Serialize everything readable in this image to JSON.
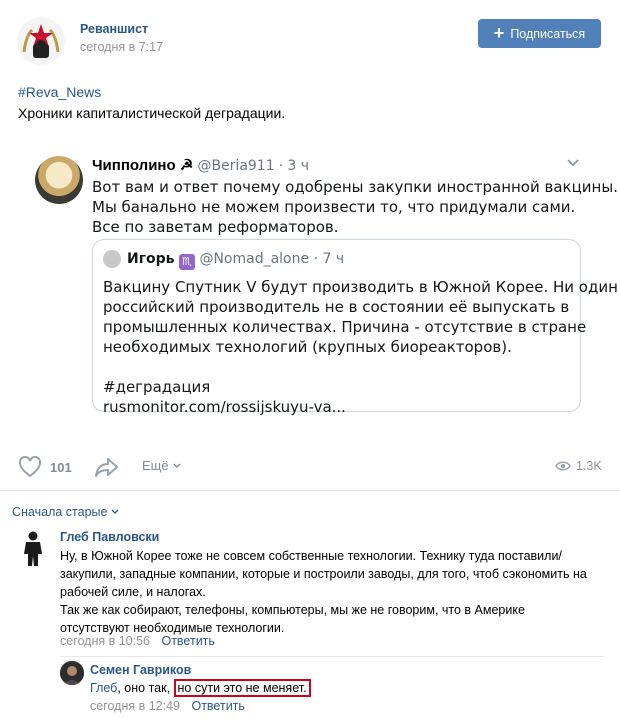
{
  "post": {
    "author": "Реваншист",
    "date": "сегодня в 7:17",
    "subscribe_label": "Подписаться",
    "hashtag": "#Reva_News",
    "text": "Хроники капиталистической деградации."
  },
  "tweet": {
    "name": "Чипполино",
    "name_emoji": "☭",
    "handle": "@Beria911",
    "time": "3 ч",
    "lines": [
      "Вот вам и ответ почему одобрены закупки иностранной вакцины.",
      "Мы банально не можем произвести то, что придумали сами.",
      "Все по заветам реформаторов."
    ],
    "quote": {
      "name": "Игорь",
      "badge": "♏",
      "handle": "@Nomad_alone",
      "time": "7 ч",
      "lines": [
        "Вакцину Спутник V будут производить в Южной Корее. Ни один",
        "российский производитель не в состоянии её выпускать в",
        "промышленных количествах. Причина - отсутствие в стране",
        "необходимых технологий (крупных биореакторов).",
        "",
        "#деградация",
        "rusmonitor.com/rossijskuyu-va..."
      ]
    }
  },
  "actions": {
    "likes": "101",
    "more": "Ещё",
    "views": "1.3K"
  },
  "comments": {
    "sort_label": "Сначала старые",
    "items": [
      {
        "author": "Глеб Павловски",
        "lines": [
          "Ну, в Южной Корее тоже не совсем собственные технологии. Технику туда поставили/",
          "закупили, западные компании, которые и построили заводы, для того, чтоб сэкономить на",
          "рабочей силе, и налогах.",
          "Так же как собирают, телефоны, компьютеры, мы же не говорим, что в Америке",
          "отсутствуют необходимые технологии."
        ],
        "date": "сегодня в 10:56",
        "reply": "Ответить"
      },
      {
        "author": "Семен Гавриков",
        "mention": "Глеб",
        "text_before": ", оно так, ",
        "highlighted": "но сути это не меняет.",
        "date": "сегодня в 12:49",
        "reply": "Ответить"
      }
    ]
  },
  "icons": {
    "like": "heart-icon",
    "share": "share-arrow-icon",
    "views": "eye-icon",
    "chevron": "chevron-down-icon"
  }
}
